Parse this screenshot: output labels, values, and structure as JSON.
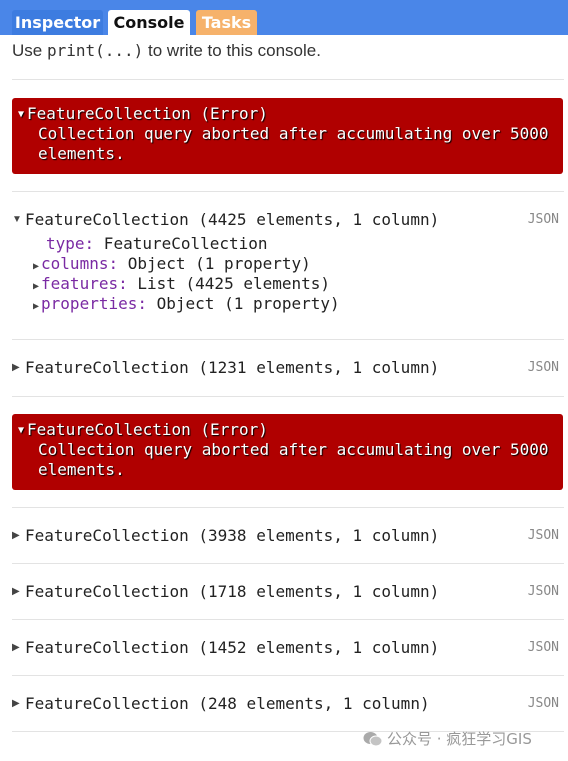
{
  "tabs": [
    {
      "label": "Inspector"
    },
    {
      "label": "Console"
    },
    {
      "label": "Tasks"
    }
  ],
  "hint": {
    "before": "Use ",
    "code": "print(...)",
    "after": " to write to this console."
  },
  "errors": [
    {
      "title": "FeatureCollection (Error)",
      "message": "Collection query aborted after accumulating over 5000 elements."
    },
    {
      "title": "FeatureCollection (Error)",
      "message": "Collection query aborted after accumulating over 5000 elements."
    }
  ],
  "expanded": {
    "label": "FeatureCollection (4425 elements, 1 column)",
    "json": "JSON",
    "props": [
      {
        "key": "type:",
        "value": " FeatureCollection"
      },
      {
        "key": "columns:",
        "value": " Object (1 property)"
      },
      {
        "key": "features:",
        "value": " List (4425 elements)"
      },
      {
        "key": "properties:",
        "value": " Object (1 property)"
      }
    ]
  },
  "rows": [
    {
      "label": "FeatureCollection (1231 elements, 1 column)",
      "json": "JSON"
    },
    {
      "label": "FeatureCollection (3938 elements, 1 column)",
      "json": "JSON"
    },
    {
      "label": "FeatureCollection (1718 elements, 1 column)",
      "json": "JSON"
    },
    {
      "label": "FeatureCollection (1452 elements, 1 column)",
      "json": "JSON"
    },
    {
      "label": "FeatureCollection (248 elements, 1 column)",
      "json": "JSON"
    }
  ],
  "watermark": "公众号 · 疯狂学习GIS"
}
